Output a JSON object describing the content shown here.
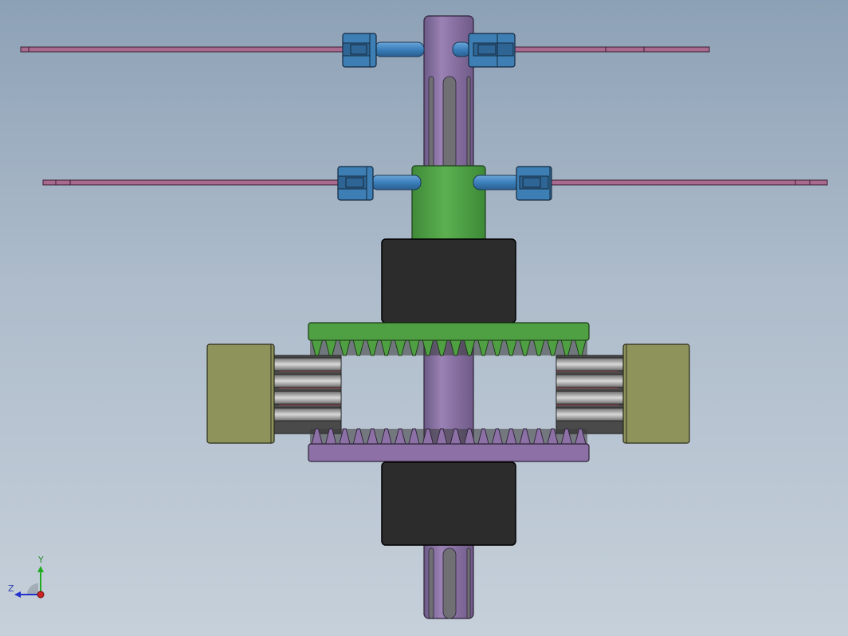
{
  "viewport": {
    "background_top": "#8da1b6",
    "background_bottom": "#c6d0da"
  },
  "model": {
    "colors": {
      "shaft": "#8b72a4",
      "shaft_slot": "#6f6f74",
      "hub": "#4e9a44",
      "upper_gear": "#4fa042",
      "lower_gear": "#8c70a6",
      "bearing_block": "#2c2c2c",
      "side_block": "#8e935c",
      "rollers": "#9a9a9a",
      "clevis": "#3d7fb4",
      "pin": "#3f86c4",
      "blade": "#a96a90"
    },
    "gear_teeth": 20
  },
  "triad": {
    "x_axis_label": "",
    "y_axis_label": "Y",
    "z_axis_label": "Z",
    "y_color": "#22aa22",
    "z_color": "#2233cc",
    "origin_color": "#cc2222"
  }
}
